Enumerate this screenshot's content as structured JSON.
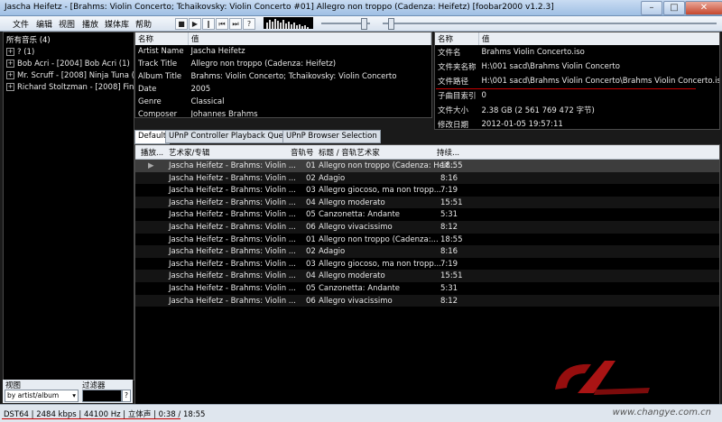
{
  "title_bar": {
    "title": "Jascha Heifetz - [Brahms: Violin Concerto; Tchaikovsky: Violin Concerto #01] Allegro non troppo (Cadenza: Heifetz)   [foobar2000 v1.2.3]",
    "minimize": "–",
    "maximize": "□",
    "close": "✕"
  },
  "menu": [
    "文件",
    "编辑",
    "视图",
    "播放",
    "媒体库",
    "帮助"
  ],
  "toolbar": {
    "stop": "■",
    "play": "▶",
    "pause": "‖",
    "prev": "⏮",
    "next": "⏭",
    "rand": "?"
  },
  "library": {
    "header": "所有音乐 (4)",
    "items": [
      "? (1)",
      "Bob Acri - [2004] Bob Acri (1)",
      "Mr. Scruff - [2008] Ninja Tuna (1)",
      "Richard Stoltzman - [2008] Fine M"
    ],
    "view_label": "视图",
    "filter_label": "过滤器",
    "view_value": "by artist/album",
    "filter_help": "?"
  },
  "properties_left": {
    "col_name": "名称",
    "col_value": "值",
    "rows": [
      {
        "name": "Artist Name",
        "value": "Jascha Heifetz"
      },
      {
        "name": "Track Title",
        "value": "Allegro non troppo (Cadenza: Heifetz)"
      },
      {
        "name": "Album Title",
        "value": "Brahms: Violin Concerto; Tchaikovsky: Violin Concerto"
      },
      {
        "name": "Date",
        "value": "2005"
      },
      {
        "name": "Genre",
        "value": "Classical"
      },
      {
        "name": "Composer",
        "value": "Johannes Brahms"
      }
    ]
  },
  "properties_right": {
    "col_name": "名称",
    "col_value": "值",
    "rows": [
      {
        "name": "文件名",
        "value": "Brahms Violin Concerto.iso"
      },
      {
        "name": "文件夹名称",
        "value": "H:\\001 sacd\\Brahms Violin Concerto"
      },
      {
        "name": "文件路径",
        "value": "H:\\001 sacd\\Brahms Violin Concerto\\Brahms Violin Concerto.iso"
      },
      {
        "name": "子曲目索引",
        "value": "0"
      },
      {
        "name": "文件大小",
        "value": "2.38 GB (2 561 769 472 字节)"
      },
      {
        "name": "修改日期",
        "value": "2012-01-05 19:57:11"
      }
    ]
  },
  "tabs": [
    "Default",
    "UPnP Controller Playback Queue",
    "UPnP Browser Selection"
  ],
  "playlist": {
    "columns": {
      "playing": "播放...",
      "artist_album": "艺术家/专辑",
      "track_no": "音轨号",
      "title_artist": "标题 / 音轨艺术家",
      "duration": "持续..."
    },
    "rows": [
      {
        "artist": "Jascha Heifetz - Brahms: Violin ...",
        "no": "01",
        "title": "Allegro non troppo (Cadenza: Heif...",
        "dur": "18:55",
        "playing": true
      },
      {
        "artist": "Jascha Heifetz - Brahms: Violin ...",
        "no": "02",
        "title": "Adagio",
        "dur": "8:16"
      },
      {
        "artist": "Jascha Heifetz - Brahms: Violin ...",
        "no": "03",
        "title": "Allegro giocoso, ma non tropp...",
        "dur": "7:19"
      },
      {
        "artist": "Jascha Heifetz - Brahms: Violin ...",
        "no": "04",
        "title": "Allegro moderato",
        "dur": "15:51"
      },
      {
        "artist": "Jascha Heifetz - Brahms: Violin ...",
        "no": "05",
        "title": "Canzonetta: Andante",
        "dur": "5:31"
      },
      {
        "artist": "Jascha Heifetz - Brahms: Violin ...",
        "no": "06",
        "title": "Allegro vivacissimo",
        "dur": "8:12"
      },
      {
        "artist": "Jascha Heifetz - Brahms: Violin ...",
        "no": "01",
        "title": "Allegro non troppo (Cadenza:...",
        "dur": "18:55"
      },
      {
        "artist": "Jascha Heifetz - Brahms: Violin ...",
        "no": "02",
        "title": "Adagio",
        "dur": "8:16"
      },
      {
        "artist": "Jascha Heifetz - Brahms: Violin ...",
        "no": "03",
        "title": "Allegro giocoso, ma non tropp...",
        "dur": "7:19"
      },
      {
        "artist": "Jascha Heifetz - Brahms: Violin ...",
        "no": "04",
        "title": "Allegro moderato",
        "dur": "15:51"
      },
      {
        "artist": "Jascha Heifetz - Brahms: Violin ...",
        "no": "05",
        "title": "Canzonetta: Andante",
        "dur": "5:31"
      },
      {
        "artist": "Jascha Heifetz - Brahms: Violin ...",
        "no": "06",
        "title": "Allegro vivacissimo",
        "dur": "8:12"
      }
    ]
  },
  "status": "DST64 | 2484 kbps | 44100 Hz | 立体声 | 0:38 / 18:55",
  "watermark": "www.changye.com.cn",
  "colors": {
    "accent_red": "#c80000"
  }
}
